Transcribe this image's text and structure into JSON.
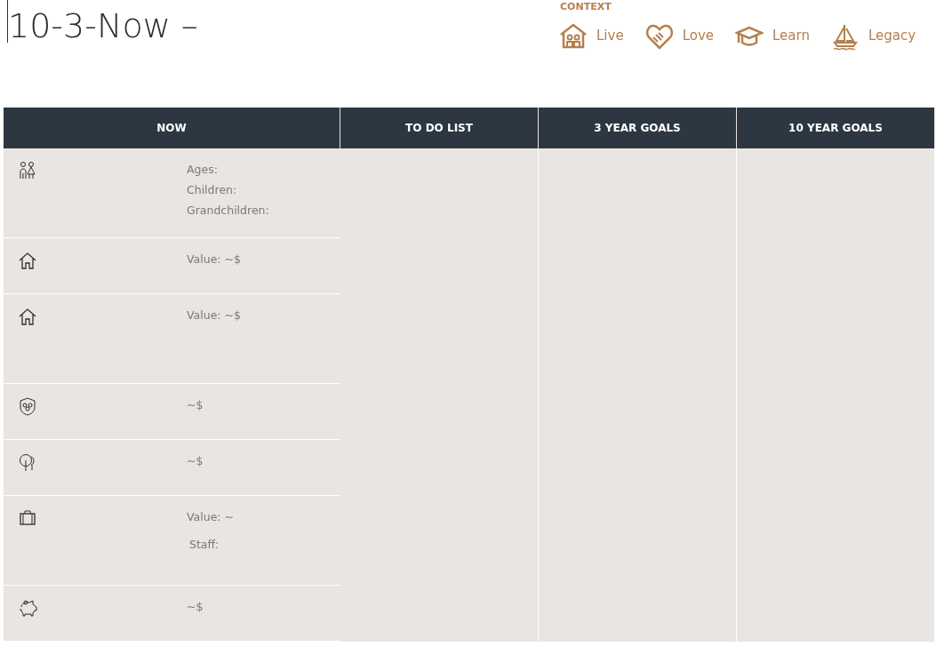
{
  "title": "10-3-Now –",
  "context": {
    "label": "CONTEXT",
    "items": [
      {
        "label": "Live"
      },
      {
        "label": "Love"
      },
      {
        "label": "Learn"
      },
      {
        "label": "Legacy"
      }
    ]
  },
  "table": {
    "columns": [
      "NOW",
      "TO DO LIST",
      "3 YEAR GOALS",
      "10 YEAR GOALS"
    ],
    "rows": [
      {
        "kind": "tall",
        "lines": [
          "Ages:",
          "Children:",
          "Grandchildren:"
        ]
      },
      {
        "kind": "short",
        "lines": [
          "Value: ~$"
        ]
      },
      {
        "kind": "tall",
        "lines": [
          "Value: ~$"
        ]
      },
      {
        "kind": "short",
        "lines": [
          "~$"
        ]
      },
      {
        "kind": "short",
        "lines": [
          "~$"
        ]
      },
      {
        "kind": "tall",
        "lines": [
          "Value: ~",
          "Staff:"
        ]
      },
      {
        "kind": "short",
        "lines": [
          "~$"
        ]
      }
    ]
  }
}
